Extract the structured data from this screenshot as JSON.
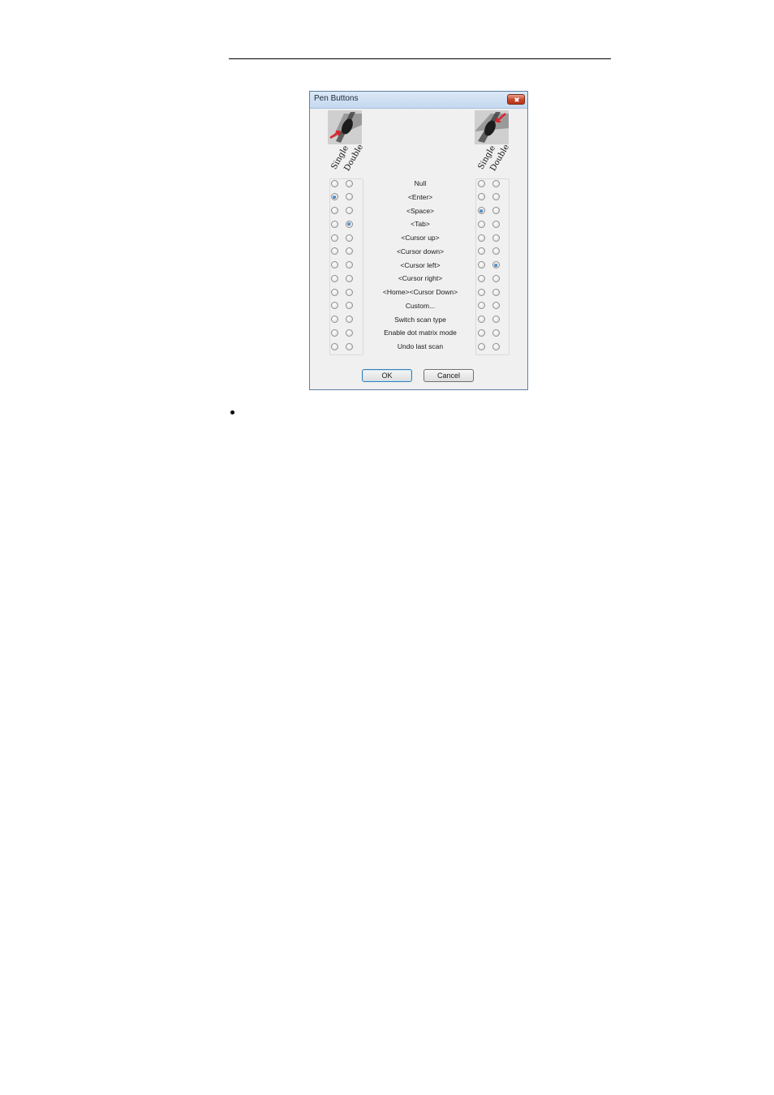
{
  "dialog": {
    "title": "Pen Buttons",
    "column_headers": {
      "single": "Single",
      "double": "Double"
    },
    "options": [
      "Null",
      "<Enter>",
      "<Space>",
      "<Tab>",
      "<Cursor up>",
      "<Cursor down>",
      "<Cursor left>",
      "<Cursor right>",
      "<Home><Cursor Down>",
      "Custom...",
      "Switch scan type",
      "Enable dot matrix mode",
      "Undo last scan"
    ],
    "selected": {
      "left_button": {
        "single": "<Enter>",
        "double": "<Tab>"
      },
      "right_button": {
        "single": "<Space>",
        "double": "<Cursor left>"
      }
    },
    "buttons": {
      "ok": "OK",
      "cancel": "Cancel"
    },
    "icons": {
      "close": "close-icon",
      "pen_left": "pen-button-left-icon",
      "pen_right": "pen-button-right-icon"
    },
    "colors": {
      "title_bar": "#c4d8ef",
      "close": "#c8452a",
      "radio_selected": "#1a4f8a",
      "pen_arrow": "#e0202a"
    }
  }
}
